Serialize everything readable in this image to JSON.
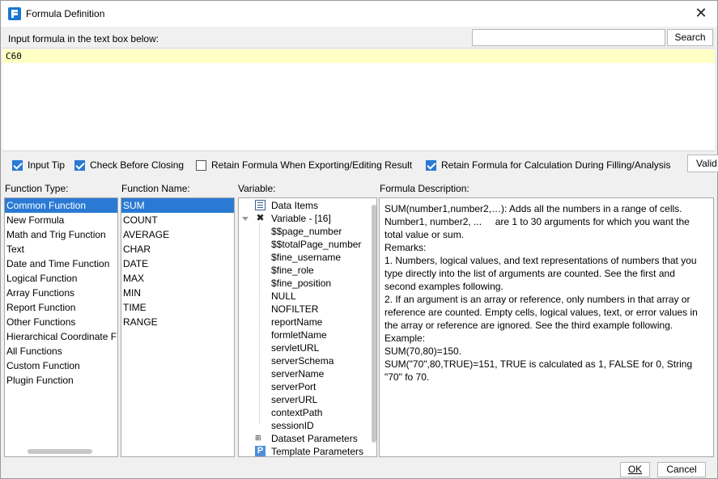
{
  "window": {
    "title": "Formula Definition"
  },
  "instruction": "Input formula in the text box below:",
  "search": {
    "value": "",
    "placeholder": "",
    "button_label": "Search"
  },
  "editor": {
    "formula": "C60",
    "highlight_color": "#ffffc6"
  },
  "options": [
    {
      "label": "Input Tip",
      "checked": true
    },
    {
      "label": "Check Before Closing",
      "checked": true
    },
    {
      "label": "Retain Formula When Exporting/Editing Result",
      "checked": false
    },
    {
      "label": "Retain Formula for Calculation During Filling/Analysis",
      "checked": true
    }
  ],
  "validate_button": "Valid",
  "function_type": {
    "header": "Function Type:",
    "items": [
      "Common Function",
      "New Formula",
      "Math and Trig Function",
      "Text",
      "Date and Time Function",
      "Logical Function",
      "Array Functions",
      "Report Function",
      "Other Functions",
      "Hierarchical Coordinate F",
      "All Functions",
      "Custom Function",
      "Plugin Function"
    ],
    "selected": 0
  },
  "function_name": {
    "header": "Function Name:",
    "items": [
      "SUM",
      "COUNT",
      "AVERAGE",
      "CHAR",
      "DATE",
      "MAX",
      "MIN",
      "TIME",
      "RANGE"
    ],
    "selected": 0
  },
  "variable": {
    "header": "Variable:",
    "data_items": "Data Items",
    "variable_group": "Variable - [16]",
    "variables": [
      "$$page_number",
      "$$totalPage_number",
      "$fine_username",
      "$fine_role",
      "$fine_position",
      "NULL",
      "NOFILTER",
      "reportName",
      "formletName",
      "servletURL",
      "serverSchema",
      "serverName",
      "serverPort",
      "serverURL",
      "contextPath",
      "sessionID"
    ],
    "dataset_parameters": "Dataset Parameters",
    "template_parameters": "Template Parameters"
  },
  "description": {
    "header": "Formula Description:",
    "lines": [
      "SUM(number1,number2,…): Adds all the numbers in a range of cells.",
      "Number1, number2, ...     are 1 to 30 arguments for which you want the",
      "total value or sum.",
      "Remarks:",
      "1. Numbers, logical values, and text representations of numbers that you",
      "type directly into the list of arguments are counted. See the first and",
      "second examples following.",
      "2. If an argument is an array or reference, only numbers in that array or",
      "reference are counted. Empty cells, logical values, text, or error values in",
      "the array or reference are ignored. See the third example following.",
      "Example:",
      "SUM(70,80)=150.",
      "SUM(\"70\",80,TRUE)=151, TRUE is calculated as 1, FALSE for 0, String",
      "\"70\" fo 70."
    ]
  },
  "footer": {
    "ok": "OK",
    "cancel": "Cancel"
  },
  "colors": {
    "accent": "#2a7ad4",
    "selection": "#2a7ad4"
  }
}
